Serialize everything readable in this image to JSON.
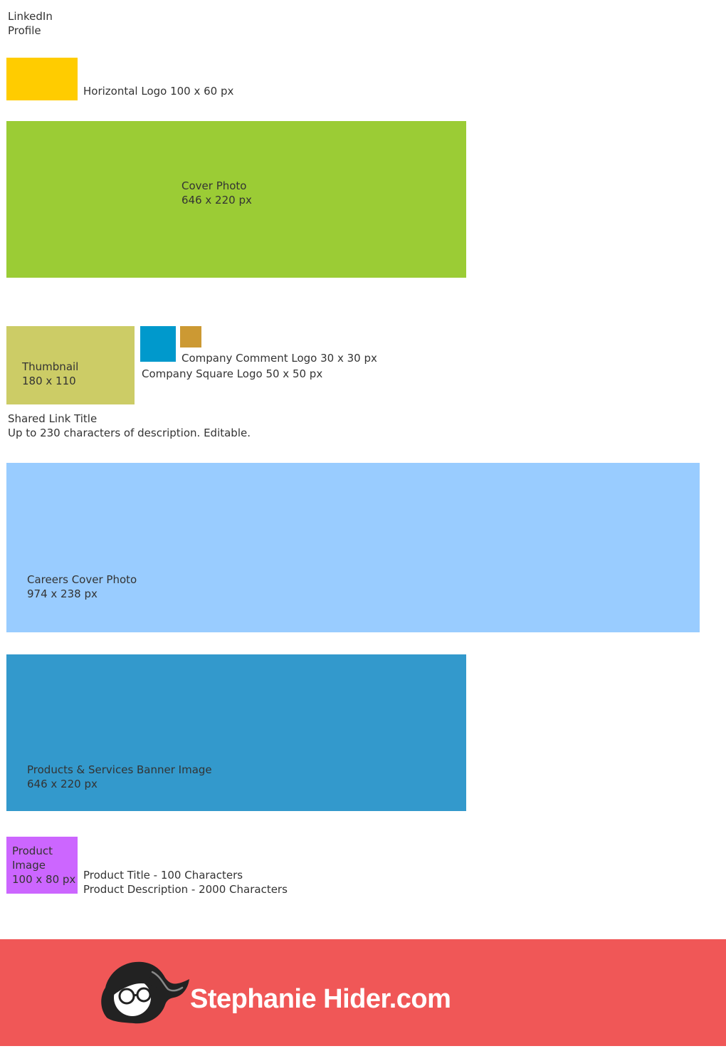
{
  "header": {
    "title_line1": "LinkedIn",
    "title_line2": "Profile"
  },
  "horizontal_logo": {
    "label": "Horizontal Logo 100 x 60 px",
    "color": "#FFCC00"
  },
  "cover_photo": {
    "line1": "Cover Photo",
    "line2": "646 x 220 px",
    "color": "#9BCC35"
  },
  "thumbnail": {
    "line1": "Thumbnail",
    "line2": "180 x 110",
    "color": "#CCCC66"
  },
  "company_square_logo": {
    "label": "Company Square Logo 50 x 50 px",
    "color": "#0099CC"
  },
  "company_comment_logo": {
    "label": "Company Comment Logo 30 x 30 px",
    "color": "#CC9933"
  },
  "shared_link": {
    "title": "Shared Link Title",
    "description": "Up to 230 characters of description. Editable."
  },
  "careers_cover": {
    "line1": "Careers Cover Photo",
    "line2": "974 x 238 px",
    "color": "#99CCFF"
  },
  "products_banner": {
    "line1": "Products & Services Banner Image",
    "line2": "646 x 220 px",
    "color": "#3399CC"
  },
  "product_image": {
    "line1": "Product",
    "line2": "Image",
    "line3": "100 x 80 px",
    "color": "#CC66FF"
  },
  "product_text": {
    "title_limit": "Product Title - 100 Characters",
    "description_limit": "Product Description - 2000 Characters"
  },
  "footer": {
    "brand": "Stephanie Hider.com",
    "color": "#F05757",
    "logo_icon": "stephanie-hider-mascot-icon"
  }
}
